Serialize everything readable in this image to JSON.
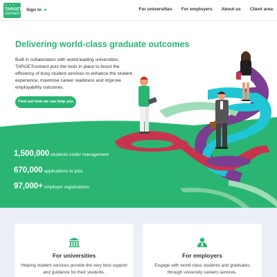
{
  "header": {
    "logo": {
      "dots": "• • •",
      "line1": "TARGET",
      "line2": "connect"
    },
    "signin": {
      "label": "Sign in",
      "icon": "sign-in-arrow-icon"
    },
    "nav": [
      "For universities",
      "For employers",
      "About us",
      "Client area"
    ]
  },
  "hero": {
    "title": "Delivering world-class graduate outcomes",
    "description": "Built in collaboration with world-leading universities, TARGETconnect puts the tools in place to boost the efficiency of busy student services to enhance the student experience, maximise career readiness and improve employability outcomes.",
    "cta": "Find out how we can help you"
  },
  "stats": [
    {
      "value": "1,500,000",
      "label": "students under management"
    },
    {
      "value": "670,000",
      "label": "applications to jobs"
    },
    {
      "value": "97,000+",
      "label": "employer registrations"
    }
  ],
  "cards": [
    {
      "icon": "university-icon",
      "title": "For universities",
      "description": "Helping student services provide the very best support and guidance for their students."
    },
    {
      "icon": "employers-icon",
      "title": "For employers",
      "description": "Engage with world class students and graduates through university careers services."
    }
  ],
  "colors": {
    "brand": "#2bb573",
    "lower_bg": "#eceff6",
    "red": "#c8344d",
    "purple": "#7a3d8f",
    "cyan": "#1ec6d6"
  }
}
